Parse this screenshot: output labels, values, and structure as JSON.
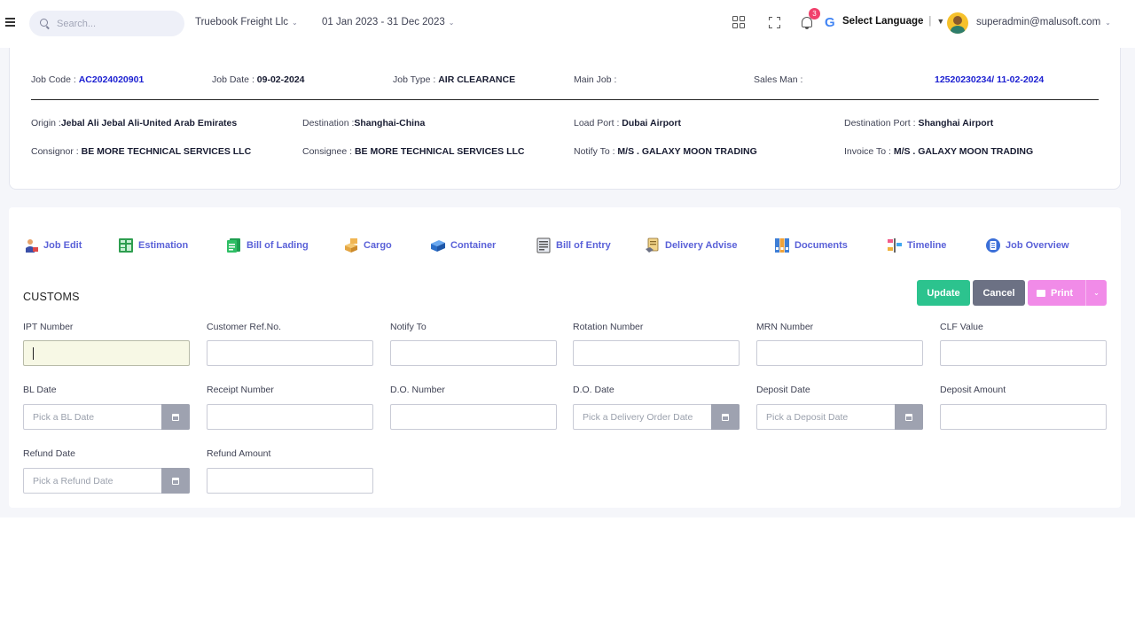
{
  "topbar": {
    "search_placeholder": "Search...",
    "company": "Truebook Freight Llc",
    "period": "01 Jan 2023 - 31 Dec 2023",
    "notification_count": "3",
    "language": "Select Language",
    "user": "superadmin@malusoft.com"
  },
  "job": {
    "job_code_label": "Job Code :",
    "job_code": "AC2024020901",
    "job_date_label": "Job Date :",
    "job_date": "09-02-2024",
    "job_type_label": "Job Type :",
    "job_type": "AIR CLEARANCE",
    "main_job_label": "Main Job :",
    "sales_man_label": "Sales Man :",
    "ref": "12520230234/ 11-02-2024",
    "origin_label": "Origin :",
    "origin": "Jebal Ali Jebal Ali-United Arab Emirates",
    "destination_label": "Destination :",
    "destination": "Shanghai-China",
    "load_port_label": "Load Port :",
    "load_port": "Dubai Airport",
    "dest_port_label": "Destination Port :",
    "dest_port": "Shanghai Airport",
    "consignor_label": "Consignor :",
    "consignor": "BE MORE TECHNICAL SERVICES LLC",
    "consignee_label": "Consignee :",
    "consignee": "BE MORE TECHNICAL SERVICES LLC",
    "notify_label": "Notify To :",
    "notify": "M/S . GALAXY MOON TRADING",
    "invoice_label": "Invoice To :",
    "invoice": "M/S . GALAXY MOON TRADING"
  },
  "tabs": [
    {
      "label": "Job Edit",
      "icon": "worker-icon"
    },
    {
      "label": "Estimation",
      "icon": "calculator-icon"
    },
    {
      "label": "Bill of Lading",
      "icon": "document-icon"
    },
    {
      "label": "Cargo",
      "icon": "boxes-icon"
    },
    {
      "label": "Container",
      "icon": "container-icon"
    },
    {
      "label": "Bill of Entry",
      "icon": "form-icon"
    },
    {
      "label": "Delivery Advise",
      "icon": "delivery-icon"
    },
    {
      "label": "Documents",
      "icon": "binders-icon"
    },
    {
      "label": "Timeline",
      "icon": "timeline-icon"
    },
    {
      "label": "Job Overview",
      "icon": "overview-icon"
    }
  ],
  "section": {
    "title": "CUSTOMS",
    "update": "Update",
    "cancel": "Cancel",
    "print": "Print"
  },
  "fields": {
    "ipt": {
      "label": "IPT Number",
      "value": ""
    },
    "customer_ref": {
      "label": "Customer Ref.No.",
      "value": ""
    },
    "notify_to": {
      "label": "Notify To",
      "value": ""
    },
    "rotation": {
      "label": "Rotation Number",
      "value": ""
    },
    "mrn": {
      "label": "MRN Number",
      "value": ""
    },
    "clf": {
      "label": "CLF Value",
      "value": ""
    },
    "bl_date": {
      "label": "BL Date",
      "placeholder": "Pick a BL Date"
    },
    "receipt": {
      "label": "Receipt Number",
      "value": ""
    },
    "do_number": {
      "label": "D.O. Number",
      "value": ""
    },
    "do_date": {
      "label": "D.O. Date",
      "placeholder": "Pick a Delivery Order Date"
    },
    "deposit_date": {
      "label": "Deposit Date",
      "placeholder": "Pick a Deposit Date"
    },
    "deposit_amount": {
      "label": "Deposit Amount",
      "value": ""
    },
    "refund_date": {
      "label": "Refund Date",
      "placeholder": "Pick a Refund Date"
    },
    "refund_amount": {
      "label": "Refund Amount",
      "value": ""
    }
  },
  "colors": {
    "accent_blue": "#5a61d8",
    "update_green": "#2cc38e",
    "cancel_gray": "#6c7184",
    "print_pink": "#f18be8"
  }
}
